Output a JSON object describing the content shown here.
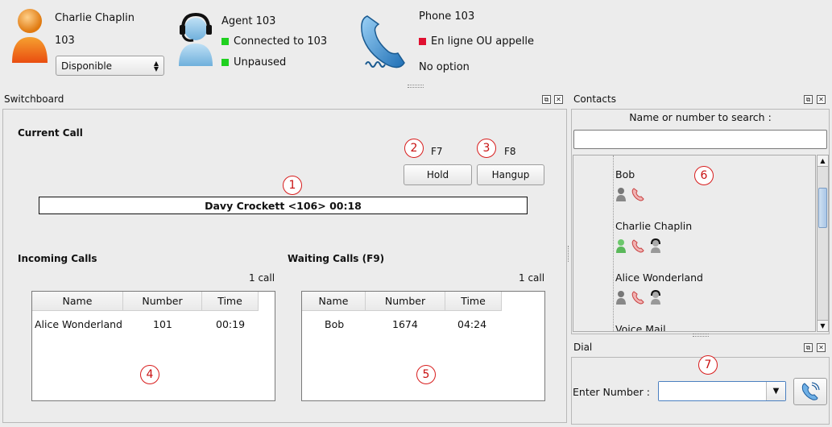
{
  "user": {
    "name": "Charlie Chaplin",
    "extension": "103",
    "status_options_selected": "Disponible"
  },
  "agent": {
    "title": "Agent 103",
    "connection": "Connected to 103",
    "pause": "Unpaused",
    "status_color": "#20d020"
  },
  "phone": {
    "title": "Phone 103",
    "state": "En ligne OU appelle",
    "option": "No option",
    "state_color": "#e01030"
  },
  "switchboard": {
    "title": "Switchboard",
    "current_call_heading": "Current Call",
    "current_call_text": "Davy Crockett <106> 00:18",
    "hold_label": "Hold",
    "hold_key": "F7",
    "hangup_label": "Hangup",
    "hangup_key": "F8",
    "incoming_heading": "Incoming Calls",
    "incoming_count": "1 call",
    "waiting_heading": "Waiting Calls (F9)",
    "waiting_count": "1 call",
    "columns": [
      "Name",
      "Number",
      "Time"
    ],
    "incoming_rows": [
      {
        "name": "Alice Wonderland",
        "number": "101",
        "time": "00:19"
      }
    ],
    "waiting_rows": [
      {
        "name": "Bob",
        "number": "1674",
        "time": "04:24"
      }
    ]
  },
  "contacts": {
    "title": "Contacts",
    "search_label": "Name or number to search :",
    "search_value": "",
    "items": [
      {
        "name": "Bob",
        "icons": [
          "person-gray-icon",
          "phone-red-icon"
        ]
      },
      {
        "name": "Charlie Chaplin",
        "icons": [
          "person-green-icon",
          "phone-red-icon",
          "agent-icon"
        ]
      },
      {
        "name": "Alice Wonderland",
        "icons": [
          "person-gray-icon",
          "phone-red-icon",
          "agent-icon"
        ]
      },
      {
        "name": "Voice Mail",
        "icons": []
      }
    ]
  },
  "dial": {
    "title": "Dial",
    "label": "Enter Number :",
    "value": ""
  },
  "annotations": [
    "1",
    "2",
    "3",
    "4",
    "5",
    "6",
    "7"
  ]
}
